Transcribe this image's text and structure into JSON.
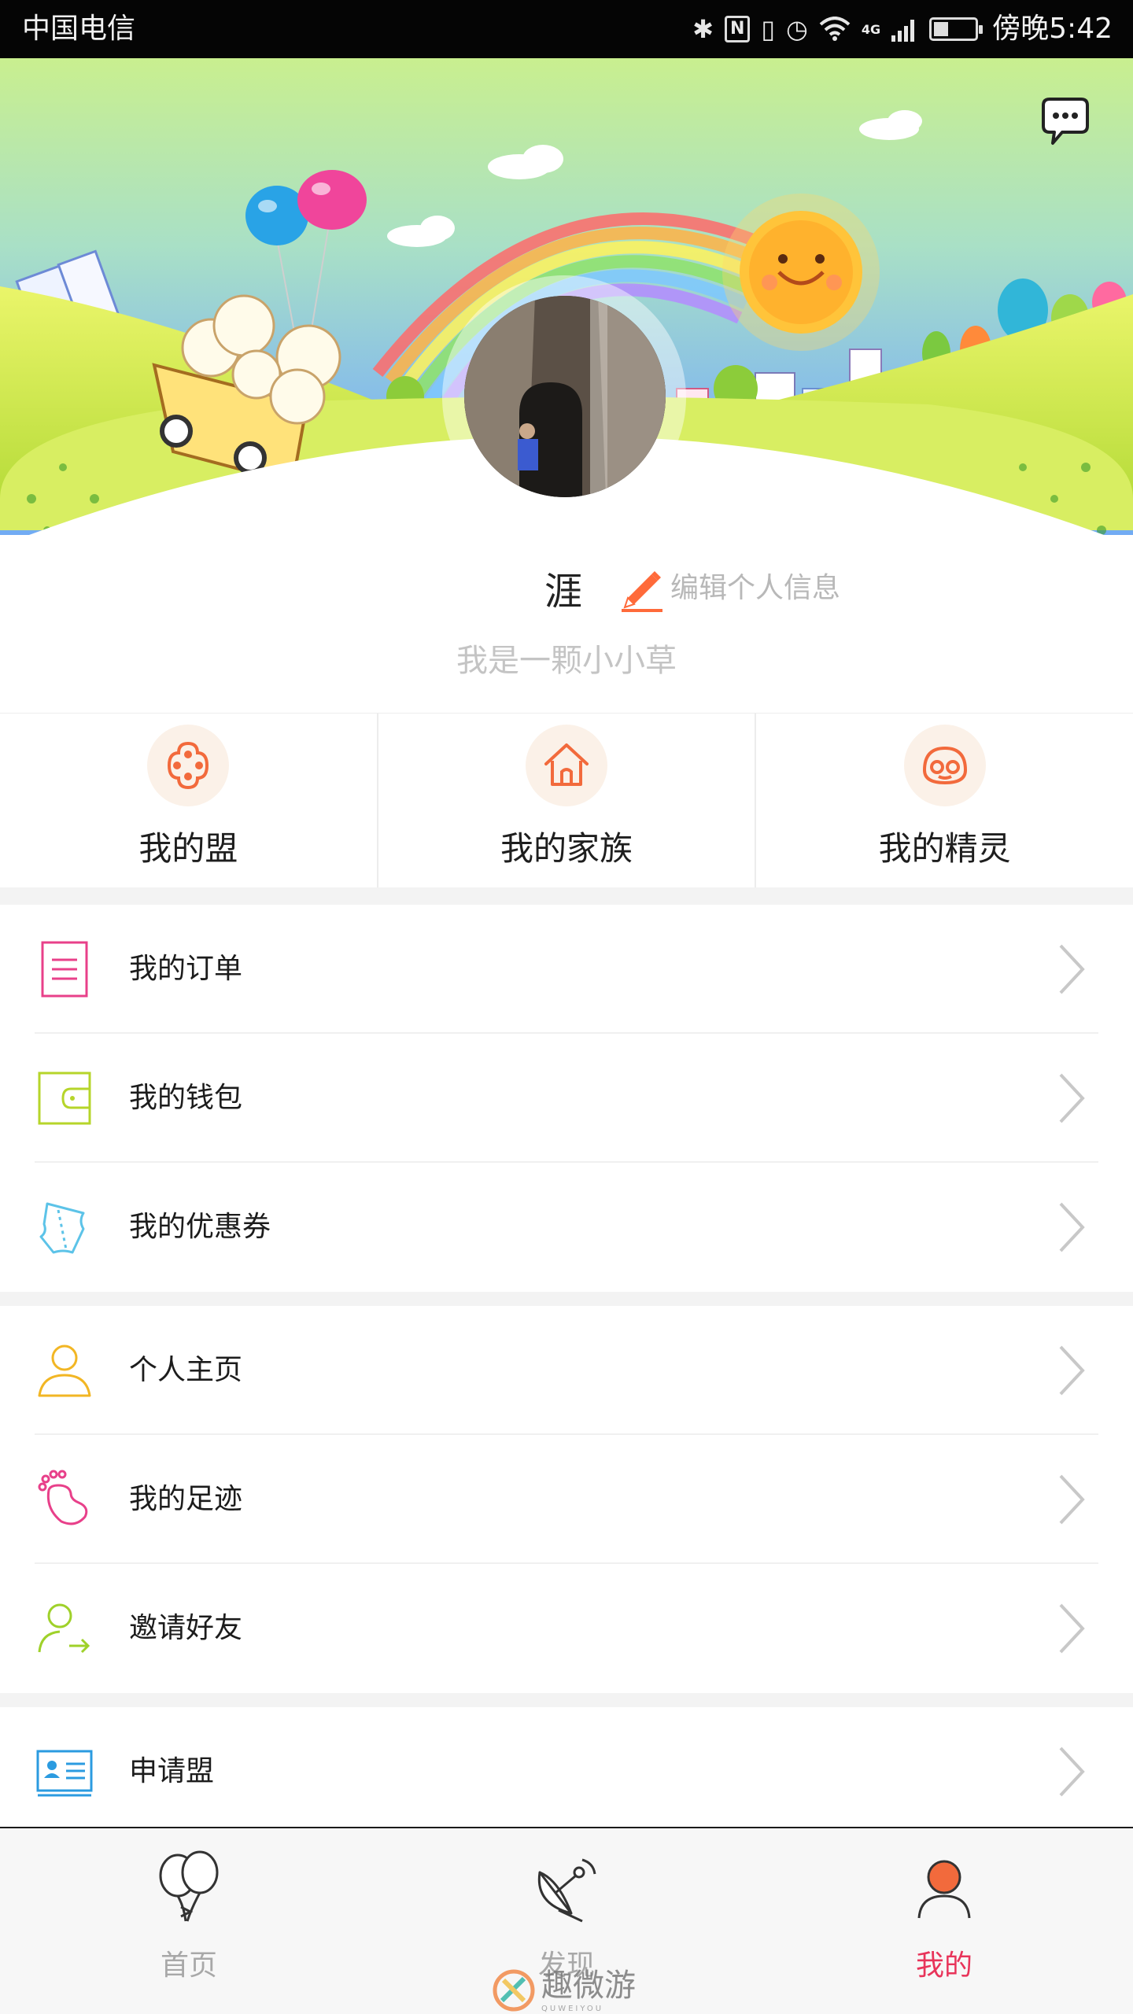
{
  "status_bar": {
    "carrier": "中国电信",
    "network": "4G",
    "time": "傍晚5:42",
    "icons": [
      "bluetooth-icon",
      "nfc-icon",
      "vibrate-icon",
      "alarm-icon",
      "wifi-icon",
      "signal-icon",
      "battery-icon"
    ]
  },
  "header": {
    "message_icon": "chat-bubble-icon"
  },
  "profile": {
    "username": "涯",
    "edit_label": "编辑个人信息",
    "motto": "我是一颗小小草"
  },
  "quick_links": [
    {
      "label": "我的盟",
      "icon": "flower-icon"
    },
    {
      "label": "我的家族",
      "icon": "house-icon"
    },
    {
      "label": "我的精灵",
      "icon": "sprite-face-icon"
    }
  ],
  "menu_groups": [
    [
      {
        "label": "我的订单",
        "icon": "order-list-icon",
        "color": "#e8408a"
      },
      {
        "label": "我的钱包",
        "icon": "wallet-icon",
        "color": "#b6d52a"
      },
      {
        "label": "我的优惠券",
        "icon": "coupon-icon",
        "color": "#5cc3e8"
      }
    ],
    [
      {
        "label": "个人主页",
        "icon": "person-icon",
        "color": "#f2b624"
      },
      {
        "label": "我的足迹",
        "icon": "footprint-icon",
        "color": "#e8408a"
      },
      {
        "label": "邀请好友",
        "icon": "invite-friend-icon",
        "color": "#9fd12a"
      }
    ],
    [
      {
        "label": "申请盟",
        "icon": "id-card-icon",
        "color": "#2b9be0"
      }
    ]
  ],
  "tab_bar": {
    "tabs": [
      {
        "label": "首页",
        "icon": "balloons-icon",
        "active": false
      },
      {
        "label": "发现",
        "icon": "satellite-dish-icon",
        "active": false
      },
      {
        "label": "我的",
        "icon": "profile-icon",
        "active": true
      }
    ],
    "active_color": "#e8345a"
  },
  "watermark": {
    "text": "趣微游",
    "subtext": "QUWEIYOU"
  }
}
